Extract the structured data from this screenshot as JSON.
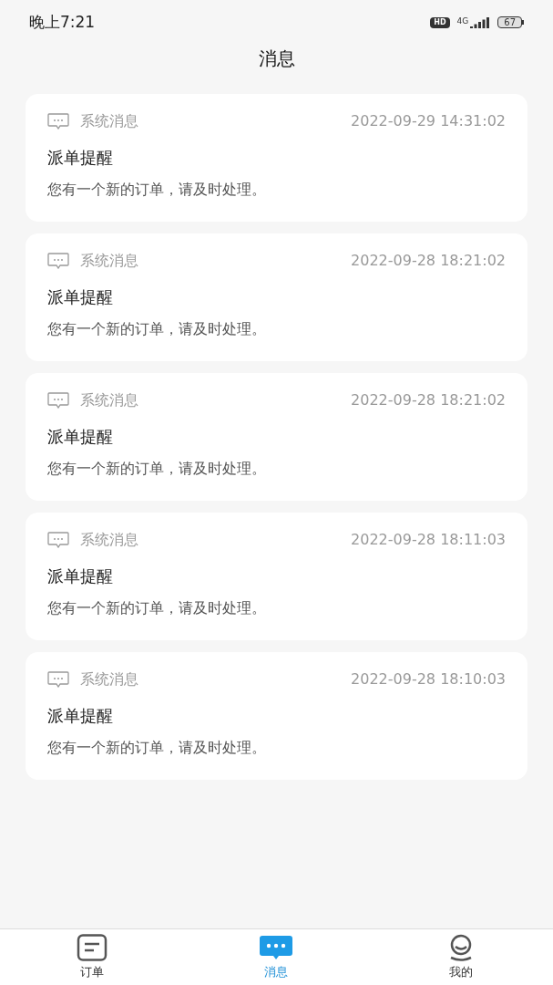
{
  "status_bar": {
    "time": "晚上7:21",
    "hd": "HD",
    "network": "4G",
    "battery": "67"
  },
  "title": "消息",
  "messages": [
    {
      "category": "系统消息",
      "time": "2022-09-29 14:31:02",
      "title": "派单提醒",
      "body": "您有一个新的订单，请及时处理。"
    },
    {
      "category": "系统消息",
      "time": "2022-09-28 18:21:02",
      "title": "派单提醒",
      "body": "您有一个新的订单，请及时处理。"
    },
    {
      "category": "系统消息",
      "time": "2022-09-28 18:21:02",
      "title": "派单提醒",
      "body": "您有一个新的订单，请及时处理。"
    },
    {
      "category": "系统消息",
      "time": "2022-09-28 18:11:03",
      "title": "派单提醒",
      "body": "您有一个新的订单，请及时处理。"
    },
    {
      "category": "系统消息",
      "time": "2022-09-28 18:10:03",
      "title": "派单提醒",
      "body": "您有一个新的订单，请及时处理。"
    }
  ],
  "tabs": [
    {
      "kind": "orders",
      "label": "订单",
      "selected": false
    },
    {
      "kind": "messages",
      "label": "消息",
      "selected": true
    },
    {
      "kind": "profile",
      "label": "我的",
      "selected": false
    }
  ]
}
